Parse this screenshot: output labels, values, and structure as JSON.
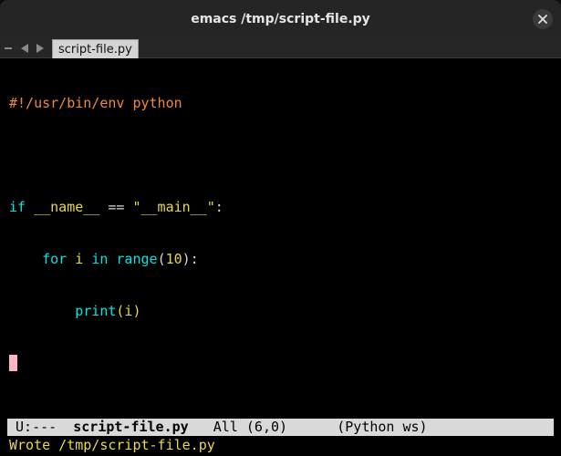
{
  "window": {
    "title": "emacs /tmp/script-file.py",
    "close_icon": "close-icon"
  },
  "tabbar": {
    "collapse_icon": "minus-icon",
    "prev_icon": "triangle-left-icon",
    "next_icon": "triangle-right-icon",
    "active_tab": "script-file.py"
  },
  "editor": {
    "lines": {
      "l1": {
        "shebang": "#!/usr/bin/env python"
      },
      "l3": {
        "kw_if": "if",
        "var": "__name__",
        "op": "==",
        "str": "\"__main__\"",
        "colon": ":"
      },
      "l4": {
        "kw_for": "for",
        "var_i": "i",
        "kw_in": "in",
        "builtin": "range",
        "paren_open": "(",
        "num": "10",
        "paren_close": "):"
      },
      "l5": {
        "fn": "print",
        "arg": "(i)"
      }
    },
    "cursor": {
      "line": 6,
      "column": 0
    }
  },
  "modeline": {
    "status": "U:---",
    "buffer_name": "script-file.py",
    "position": "All (6,0)",
    "mode": "(Python ws)"
  },
  "echo_area": {
    "message": "Wrote /tmp/script-file.py"
  },
  "colors": {
    "keyword": "#00e5e5",
    "shebang": "#f0883e",
    "string": "#e8d84a",
    "cursor": "#ffb6c1",
    "modeline_bg": "#d9d9d9",
    "echo": "#e8d84a"
  }
}
